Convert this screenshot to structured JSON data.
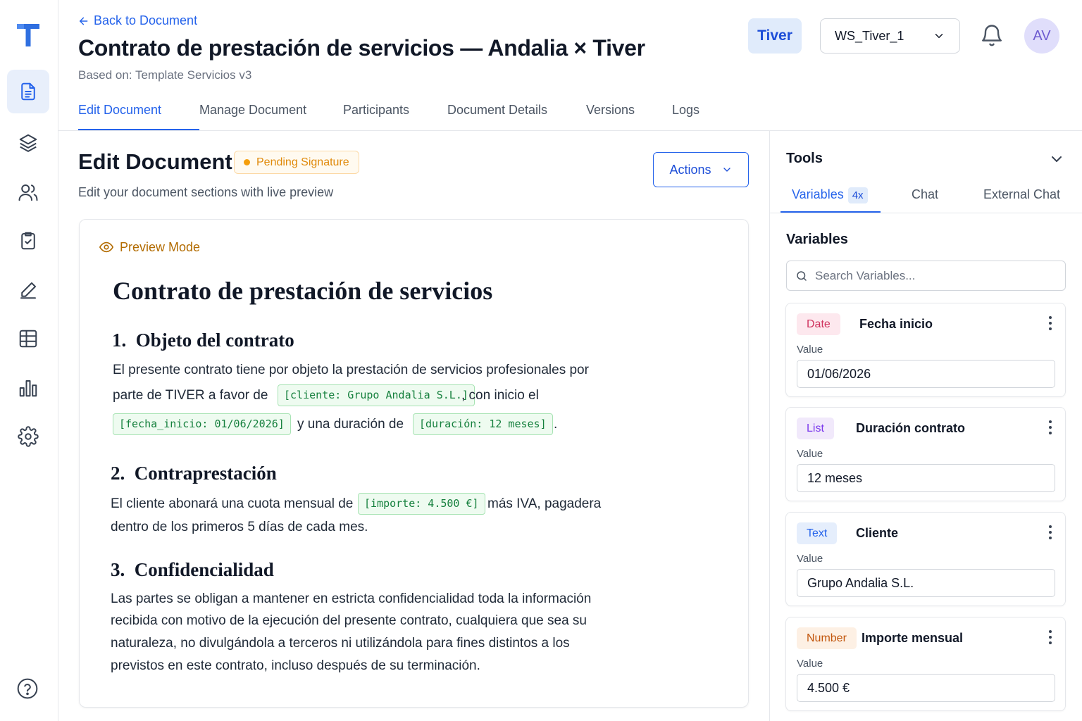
{
  "header": {
    "back_label": "Back to Document",
    "title": "Contrato de prestación de servicios — Andalia × Tiver",
    "based_on": "Based on: Template Servicios v3",
    "org": "Tiver",
    "workspace": "WS_Tiver_1",
    "avatar_initials": "AV"
  },
  "tabs": [
    {
      "label": "Edit Document"
    },
    {
      "label": "Manage Document"
    },
    {
      "label": "Participants"
    },
    {
      "label": "Document Details"
    },
    {
      "label": "Versions"
    },
    {
      "label": "Logs"
    }
  ],
  "section": {
    "title": "Edit Document",
    "status": "Pending Signature",
    "subtitle": "Edit your document sections with live preview",
    "actions_label": "Actions"
  },
  "preview": {
    "mode_label": "Preview Mode",
    "doc_title": "Contrato de prestación de servicios",
    "s1_title": "1.  Objeto del contrato",
    "s1_line1": "El presente contrato tiene por objeto la prestación de servicios profesionales por",
    "s1_line2a": "parte de TIVER a favor de",
    "s1_chip_cliente": "[cliente: Grupo Andalia S.L.]",
    "s1_line2b": ", con inicio el",
    "s1_chip_fecha": "[fecha_inicio: 01/06/2026]",
    "s1_line3a": "y una duración de",
    "s1_chip_duracion": "[duración: 12 meses]",
    "s1_line3b": ".",
    "s2_title": "2.  Contraprestación",
    "s2_line1a": "El cliente abonará una cuota mensual de",
    "s2_chip_importe": "[importe: 4.500 €]",
    "s2_line1b": "más IVA, pagadera",
    "s2_line2": "dentro de los primeros 5 días de cada mes.",
    "s3_title": "3.  Confidencialidad",
    "s3_line1": "Las partes se obligan a mantener en estricta confidencialidad toda la información",
    "s3_line2": "recibida con motivo de la ejecución del presente contrato, cualquiera que sea su",
    "s3_line3": "naturaleza, no divulgándola a terceros ni utilizándola para fines distintos a los",
    "s3_line4": "previstos en este contrato, incluso después de su terminación."
  },
  "tools": {
    "title": "Tools",
    "tab_variables": "Variables",
    "variables_count": "4x",
    "tab_chat": "Chat",
    "tab_external_chat": "External Chat",
    "variables_heading": "Variables",
    "search_placeholder": "Search Variables...",
    "value_label": "Value",
    "variables": [
      {
        "type": "Date",
        "name": "Fecha inicio",
        "value": "01/06/2026"
      },
      {
        "type": "List",
        "name": "Duración contrato",
        "value": "12 meses"
      },
      {
        "type": "Text",
        "name": "Cliente",
        "value": "Grupo Andalia S.L."
      },
      {
        "type": "Number",
        "name": "Importe mensual",
        "value": "4.500 €"
      }
    ]
  },
  "colors": {
    "accent": "#2563eb",
    "pending": "#f59e0b",
    "variable_chip": "#15803d"
  }
}
